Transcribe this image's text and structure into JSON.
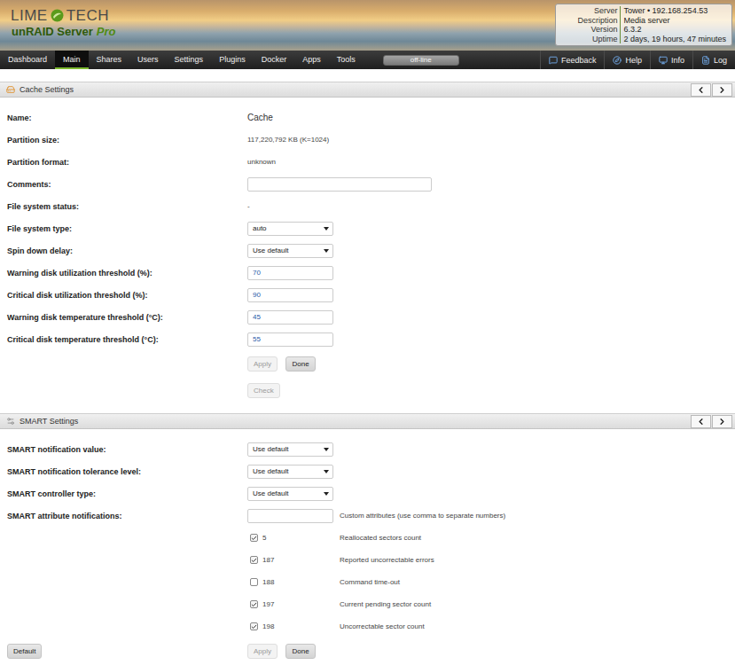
{
  "header": {
    "logo": {
      "first": "LIME",
      "second": "TECH",
      "product": "unRAID Server",
      "edition": "Pro"
    },
    "info": [
      {
        "label": "Server",
        "value": "Tower • 192.168.254.53"
      },
      {
        "label": "Description",
        "value": "Media server"
      },
      {
        "label": "Version",
        "value": "6.3.2"
      },
      {
        "label": "Uptime",
        "value": "2 days, 19 hours, 47 minutes"
      }
    ]
  },
  "nav": {
    "items": [
      {
        "label": "Dashboard",
        "selected": false
      },
      {
        "label": "Main",
        "selected": true
      },
      {
        "label": "Shares",
        "selected": false
      },
      {
        "label": "Users",
        "selected": false
      },
      {
        "label": "Settings",
        "selected": false
      },
      {
        "label": "Plugins",
        "selected": false
      },
      {
        "label": "Docker",
        "selected": false
      },
      {
        "label": "Apps",
        "selected": false
      },
      {
        "label": "Tools",
        "selected": false
      }
    ],
    "status": "off-line",
    "right_items": [
      {
        "label": "Feedback"
      },
      {
        "label": "Help"
      },
      {
        "label": "Info"
      },
      {
        "label": "Log"
      }
    ]
  },
  "cache_settings": {
    "title": "Cache Settings",
    "rows": [
      {
        "kind": "name",
        "label": "Name:",
        "value": "Cache"
      },
      {
        "kind": "static",
        "label": "Partition size:",
        "value": "117,220,792 KB (K=1024)"
      },
      {
        "kind": "static",
        "label": "Partition format:",
        "value": "unknown"
      },
      {
        "kind": "text-input",
        "label": "Comments:",
        "value": ""
      },
      {
        "kind": "static",
        "label": "File system status:",
        "value": "-"
      },
      {
        "kind": "select",
        "label": "File system type:",
        "value": "auto"
      },
      {
        "kind": "select",
        "label": "Spin down delay:",
        "value": "Use default"
      },
      {
        "kind": "number-input",
        "label": "Warning disk utilization threshold (%):",
        "value": "70"
      },
      {
        "kind": "number-input",
        "label": "Critical disk utilization threshold (%):",
        "value": "90"
      },
      {
        "kind": "number-input",
        "label": "Warning disk temperature threshold (°C):",
        "value": "45"
      },
      {
        "kind": "number-input",
        "label": "Critical disk temperature threshold (°C):",
        "value": "55"
      },
      {
        "kind": "buttons",
        "left_buttons": [],
        "buttons": [
          {
            "label": "Apply",
            "disabled": true
          },
          {
            "label": "Done",
            "disabled": false
          }
        ]
      },
      {
        "kind": "buttons",
        "left_buttons": [],
        "buttons": [
          {
            "label": "Check",
            "disabled": true
          }
        ]
      }
    ]
  },
  "smart_settings": {
    "title": "SMART Settings",
    "rows": [
      {
        "kind": "select",
        "label": "SMART notification value:",
        "value": "Use default"
      },
      {
        "kind": "select",
        "label": "SMART notification tolerance level:",
        "value": "Use default"
      },
      {
        "kind": "select",
        "label": "SMART controller type:",
        "value": "Use default"
      },
      {
        "kind": "input-hint",
        "label": "SMART attribute notifications:",
        "value": "",
        "hint": "Custom attributes (use comma to separate numbers)"
      },
      {
        "kind": "checkbox",
        "number": "5",
        "description": "Reallocated sectors count",
        "checked": true
      },
      {
        "kind": "checkbox",
        "number": "187",
        "description": "Reported uncorrectable errors",
        "checked": true
      },
      {
        "kind": "checkbox",
        "number": "188",
        "description": "Command time-out",
        "checked": false
      },
      {
        "kind": "checkbox",
        "number": "197",
        "description": "Current pending sector count",
        "checked": true
      },
      {
        "kind": "checkbox",
        "number": "198",
        "description": "Uncorrectable sector count",
        "checked": true
      },
      {
        "kind": "buttons",
        "left_buttons": [
          {
            "label": "Default",
            "disabled": false
          }
        ],
        "buttons": [
          {
            "label": "Apply",
            "disabled": true
          },
          {
            "label": "Done",
            "disabled": false
          }
        ]
      }
    ]
  }
}
